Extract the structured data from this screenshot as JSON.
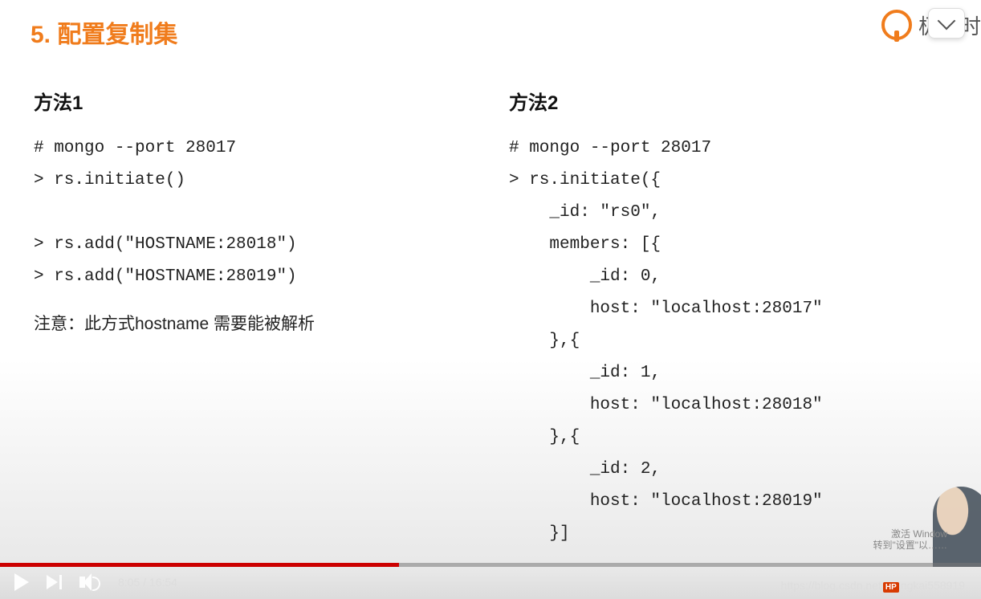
{
  "title": "5. 配置复制集",
  "brand": "极客时",
  "method1": {
    "heading": "方法1",
    "lines": [
      "# mongo --port 28017",
      "> rs.initiate()",
      "",
      "> rs.add(\"HOSTNAME:28018\")",
      "> rs.add(\"HOSTNAME:28019\")"
    ],
    "note": "注意：此方式hostname 需要能被解析"
  },
  "method2": {
    "heading": "方法2",
    "lines": [
      "# mongo --port 28017",
      "> rs.initiate({",
      "    _id: \"rs0\",",
      "    members: [{",
      "        _id: 0,",
      "        host: \"localhost:28017\"",
      "    },{",
      "        _id: 1,",
      "        host: \"localhost:28018\"",
      "    },{",
      "        _id: 2,",
      "        host: \"localhost:28019\"",
      "    }]"
    ]
  },
  "player": {
    "current": "8:05",
    "duration": "16:54",
    "progress_percent": 40.7
  },
  "watermark": {
    "line1": "激活 Window",
    "line2": "转到\"设置\"以……"
  },
  "source_url_prefix": "https://blog.csdn.net",
  "source_url_suffix": "ngkai558919",
  "hp_badge": "HP"
}
